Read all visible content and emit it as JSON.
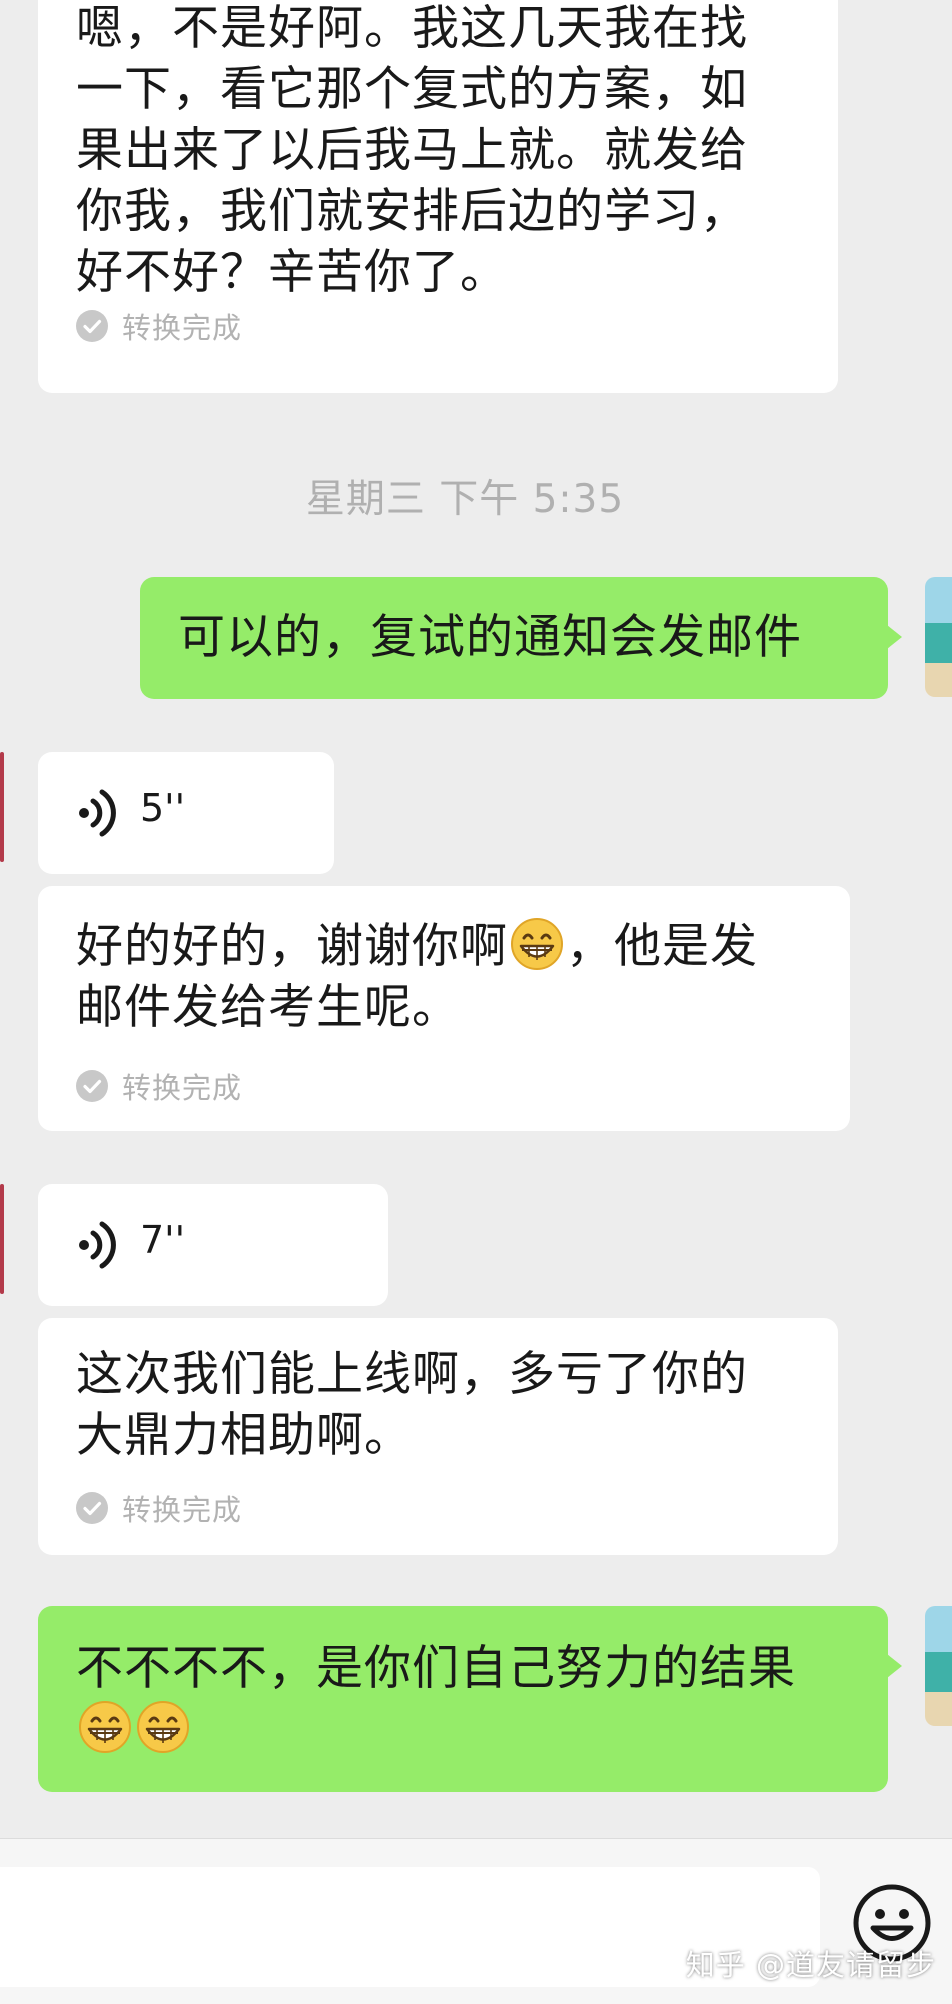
{
  "colors": {
    "background": "#ededed",
    "incoming_bubble": "#ffffff",
    "outgoing_bubble": "#95ec69",
    "muted_text": "#b2b2b2"
  },
  "messages": {
    "m1": {
      "direction": "incoming",
      "text": "嗯，不是好阿。我这几天我在找\n一下，看它那个复式的方案，如\n果出来了以后我马上就。就发给\n你我，我们就安排后边的学习，\n好不好？辛苦你了。",
      "conversion_status": "转换完成"
    },
    "timestamp": "星期三 下午 5:35",
    "m2": {
      "direction": "outgoing",
      "text": "可以的，复试的通知会发邮件"
    },
    "m3": {
      "direction": "incoming",
      "type": "voice",
      "duration": "5''"
    },
    "m4": {
      "direction": "incoming",
      "text_part1": "好的好的，谢谢你啊",
      "emoji": "grinning-face",
      "text_part2": "，他是发\n邮件发给考生呢。",
      "conversion_status": "转换完成"
    },
    "m5": {
      "direction": "incoming",
      "type": "voice",
      "duration": "7''"
    },
    "m6": {
      "direction": "incoming",
      "text": "这次我们能上线啊，多亏了你的\n大鼎力相助啊。",
      "conversion_status": "转换完成"
    },
    "m7": {
      "direction": "outgoing",
      "text": "不不不不，是你们自己努力的结果",
      "emojis": [
        "grinning-face",
        "grinning-face"
      ]
    }
  },
  "input_bar": {
    "emoji_button_icon": "smiley-icon"
  },
  "watermark": "知乎 @道友请留步"
}
